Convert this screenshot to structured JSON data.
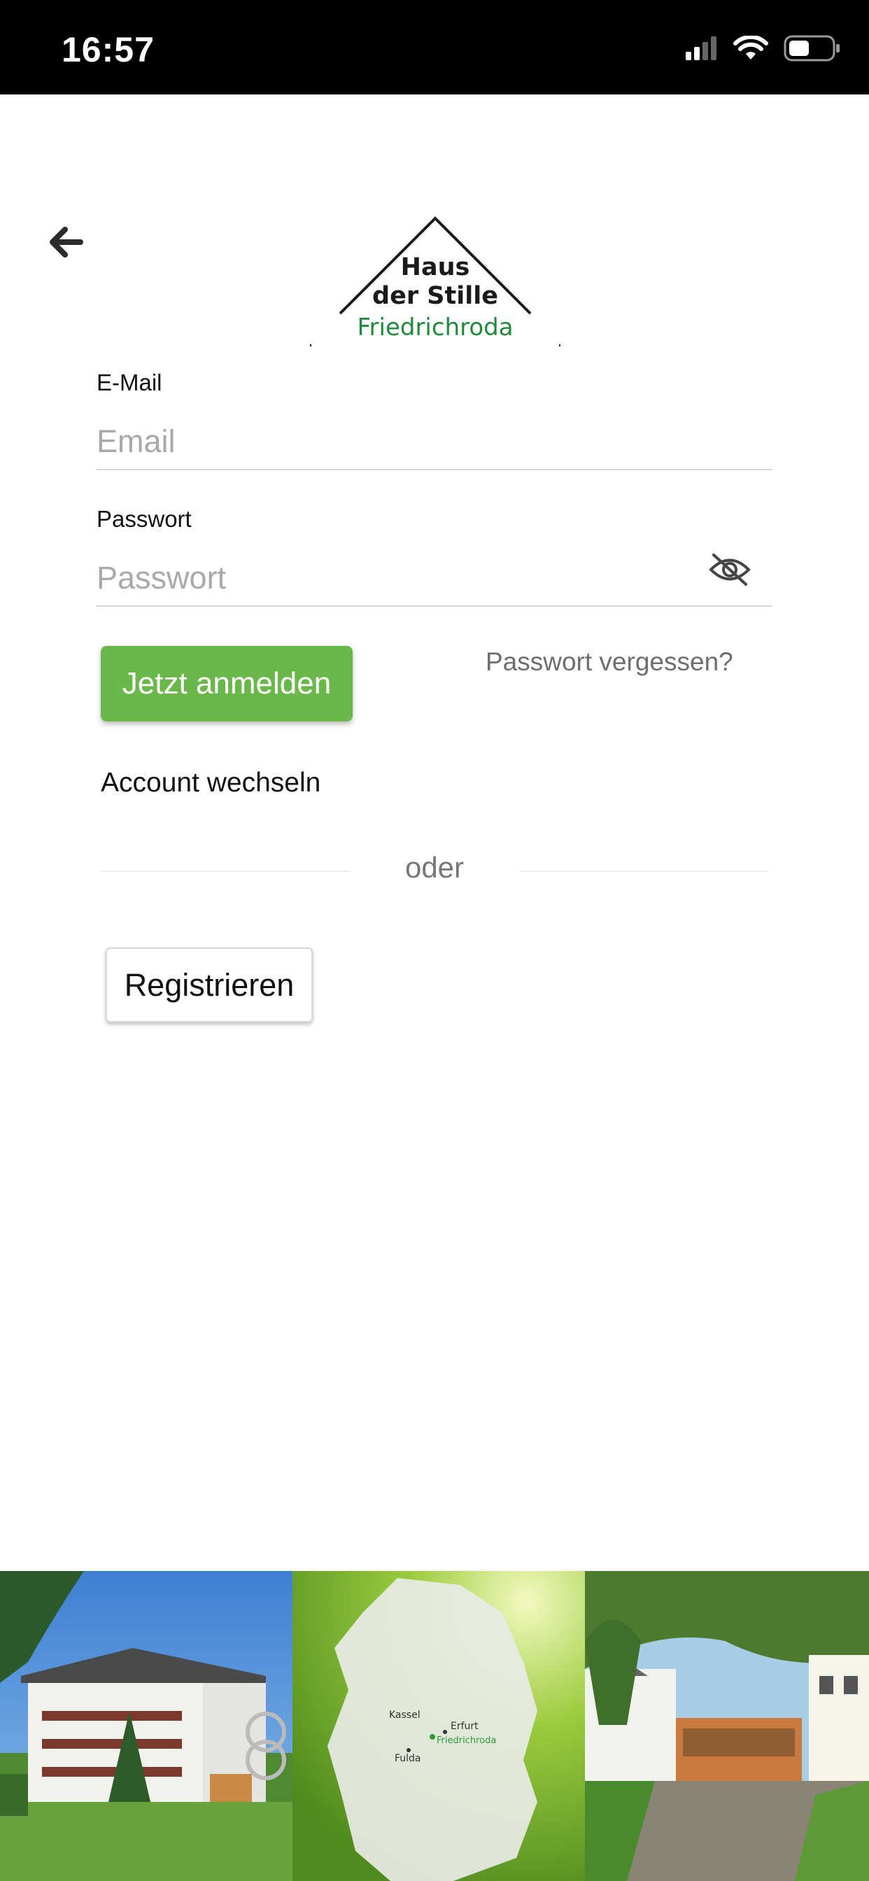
{
  "status_bar": {
    "time": "16:57",
    "icons": [
      "signal-icon",
      "wifi-icon",
      "battery-icon"
    ]
  },
  "header": {
    "back_icon": "arrow-left-icon"
  },
  "logo": {
    "line1": "Haus",
    "line2": "der Stille",
    "line3": "Friedrichroda"
  },
  "form": {
    "email": {
      "label": "E-Mail",
      "placeholder": "Email",
      "value": ""
    },
    "password": {
      "label": "Passwort",
      "placeholder": "Passwort",
      "value": "",
      "toggle_icon": "eye-slash-icon"
    },
    "login_label": "Jetzt anmelden",
    "forgot_label": "Passwort vergessen?",
    "switch_account_label": "Account wechseln",
    "divider_text": "oder",
    "register_label": "Registrieren"
  },
  "map": {
    "cities": [
      "Kassel",
      "Erfurt",
      "Friedrichroda",
      "Fulda"
    ]
  },
  "colors": {
    "accent": "#6bb84a",
    "brand_green": "#1f8a3c",
    "status_bar": "#000000"
  }
}
